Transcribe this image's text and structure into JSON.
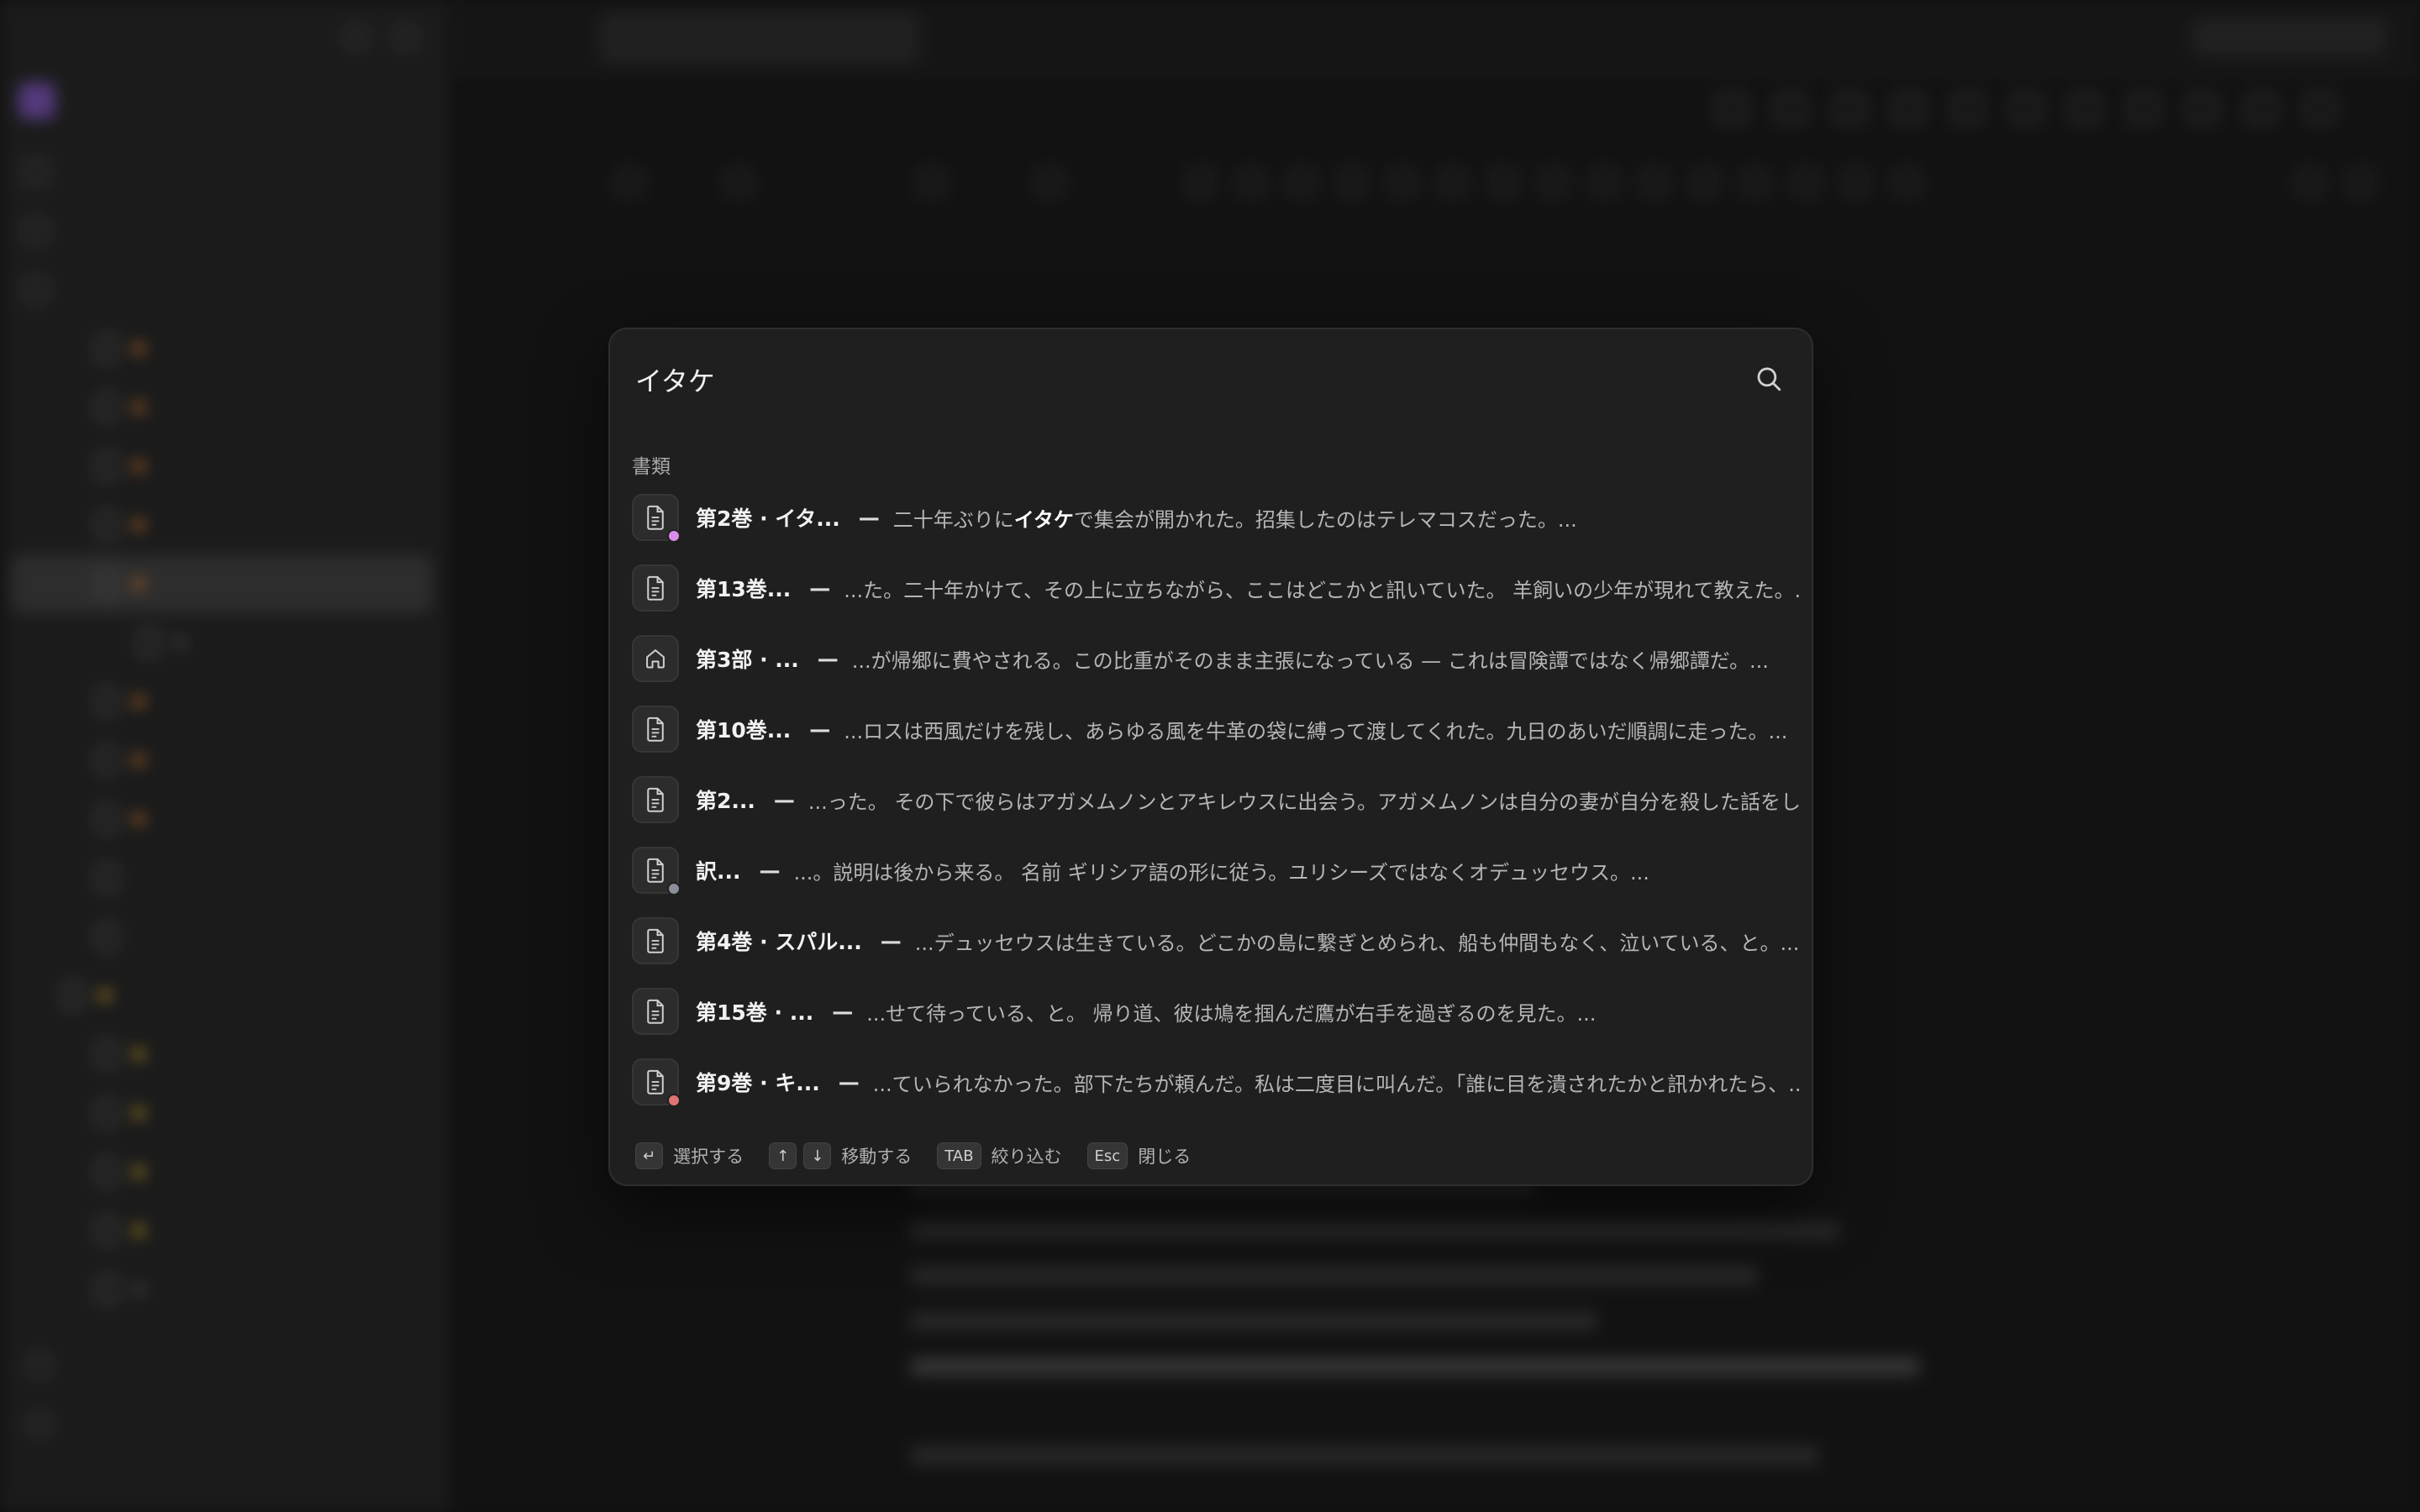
{
  "palette": {
    "query": "イタケ",
    "section_label": "書類",
    "results": [
      {
        "title": "第2巻 · イタ...",
        "pre": "二十年ぶりに",
        "hl": "イタケ",
        "post": "で集会が開かれた。招集したのはテレマコスだった。...",
        "icon": "document-icon",
        "badge": "#d98be8"
      },
      {
        "title": "第13巻...",
        "pre": "",
        "hl": "",
        "post": "...た。二十年かけて、その上に立ちながら、ここはどこかと訊いていた。 羊飼いの少年が現れて教えた。...",
        "icon": "document-icon",
        "badge": ""
      },
      {
        "title": "第3部 · ...",
        "pre": "",
        "hl": "",
        "post": "...が帰郷に費やされる。この比重がそのまま主張になっている — これは冒険譚ではなく帰郷譚だ。...",
        "icon": "home-icon",
        "badge": ""
      },
      {
        "title": "第10巻...",
        "pre": "",
        "hl": "",
        "post": "...ロスは西風だけを残し、あらゆる風を牛革の袋に縛って渡してくれた。九日のあいだ順調に走った。...",
        "icon": "document-icon",
        "badge": ""
      },
      {
        "title": "第2...",
        "pre": "",
        "hl": "",
        "post": "...った。 その下で彼らはアガメムノンとアキレウスに出会う。アガメムノンは自分の妻が自分を殺した話をし...",
        "icon": "document-icon",
        "badge": ""
      },
      {
        "title": "訳...",
        "pre": "",
        "hl": "",
        "post": "...。説明は後から来る。 名前 ギリシア語の形に従う。ユリシーズではなくオデュッセウス。...",
        "icon": "document-icon",
        "badge": "#8a8f99"
      },
      {
        "title": "第4巻 · スパル...",
        "pre": "",
        "hl": "",
        "post": "...デュッセウスは生きている。どこかの島に繋ぎとめられ、船も仲間もなく、泣いている、と。...",
        "icon": "document-icon",
        "badge": ""
      },
      {
        "title": "第15巻 · ...",
        "pre": "",
        "hl": "",
        "post": "...せて待っている、と。 帰り道、彼は鳩を掴んだ鷹が右手を過ぎるのを見た。...",
        "icon": "document-icon",
        "badge": ""
      },
      {
        "title": "第9巻 · キ...",
        "pre": "",
        "hl": "",
        "post": "...ていられなかった。部下たちが頼んだ。私は二度目に叫んだ。「誰に目を潰されたかと訊かれたら、...",
        "icon": "document-icon",
        "badge": "#e07474"
      }
    ],
    "dash": "—",
    "footer": {
      "enter_key": "↵",
      "enter_label": "選択する",
      "up_key": "↑",
      "down_key": "↓",
      "move_label": "移動する",
      "tab_key": "TAB",
      "tab_label": "絞り込む",
      "esc_key": "Esc",
      "esc_label": "閉じる"
    }
  }
}
